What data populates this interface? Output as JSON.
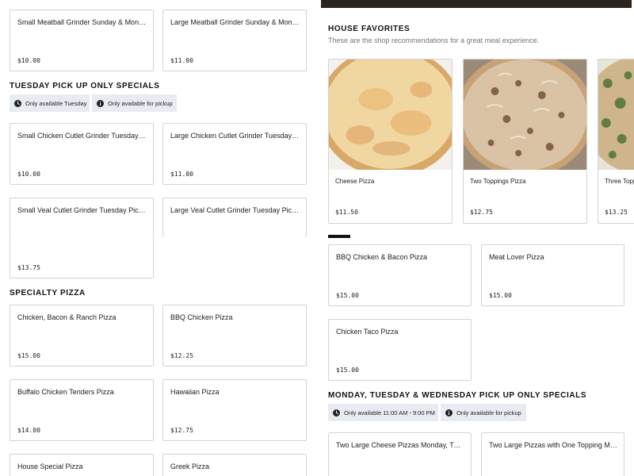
{
  "left": {
    "sunday_cards": [
      {
        "name": "Small Meatball Grinder Sunday & Monday",
        "price": "$10.00"
      },
      {
        "name": "Large Meatball Grinder Sunday & Monday",
        "price": "$11.00"
      }
    ],
    "tuesday": {
      "heading": "TUESDAY PICK UP ONLY SPECIALS",
      "chips": [
        "Only available Tuesday",
        "Only available for pickup"
      ],
      "cards": [
        {
          "name": "Small Chicken Cutlet Grinder Tuesday Pick Up",
          "price": "$10.00"
        },
        {
          "name": "Large Chicken Cutlet Grinder Tuesday Pick Up",
          "price": "$11.00"
        },
        {
          "name": "Small Veal Cutlet Grinder Tuesday Pick Up",
          "price": ""
        },
        {
          "name": "Large Veal Cutlet Grinder Tuesday Pick Up",
          "price": ""
        }
      ],
      "extra_price": "$13.75"
    },
    "specialty": {
      "heading": "SPECIALTY PIZZA",
      "cards": [
        {
          "name": "Chicken, Bacon & Ranch Pizza",
          "price": "$15.00"
        },
        {
          "name": "BBQ Chicken Pizza",
          "price": "$12.25"
        },
        {
          "name": "Buffalo Chicken Tenders Pizza",
          "price": "$14.00"
        },
        {
          "name": "Hawaiian Pizza",
          "price": "$12.75"
        },
        {
          "name": "House Special Pizza",
          "price": ""
        },
        {
          "name": "Greek Pizza",
          "price": ""
        }
      ]
    }
  },
  "right": {
    "favorites": {
      "heading": "HOUSE FAVORITES",
      "subtitle": "These are the shop recommendations for a great meal experience.",
      "items": [
        {
          "name": "Cheese Pizza",
          "price": "$11.50",
          "image": "cheese-pizza-photo"
        },
        {
          "name": "Two Toppings Pizza",
          "price": "$12.75",
          "image": "two-toppings-pizza-photo"
        },
        {
          "name": "Three Toppings Pizza",
          "price": "$13.25",
          "image": "three-toppings-pizza-photo"
        }
      ]
    },
    "pizza": {
      "cards": [
        {
          "name": "BBQ Chicken & Bacon Pizza",
          "price": "$15.00"
        },
        {
          "name": "Meat Lover Pizza",
          "price": "$15.00"
        },
        {
          "name": "Chicken Taco Pizza",
          "price": "$15.00"
        }
      ]
    },
    "mtw": {
      "heading": "MONDAY, TUESDAY & WEDNESDAY PICK UP ONLY SPECIALS",
      "chips": [
        "Only available 11:00 AM - 9:00 PM",
        "Only available for pickup"
      ],
      "cards": [
        {
          "name": "Two Large Cheese Pizzas Monday, Tuesday & Wednesday",
          "price": ""
        },
        {
          "name": "Two Large Pizzas with One Topping Monday, Tuesday & Wednesday",
          "price": ""
        }
      ]
    }
  },
  "icons": {
    "clock": "clock-icon",
    "info": "info-icon"
  },
  "colors": {
    "chip_bg": "#e8ecf2",
    "border": "#d4d4d4",
    "text": "#1a1a1a",
    "muted": "#777777"
  }
}
